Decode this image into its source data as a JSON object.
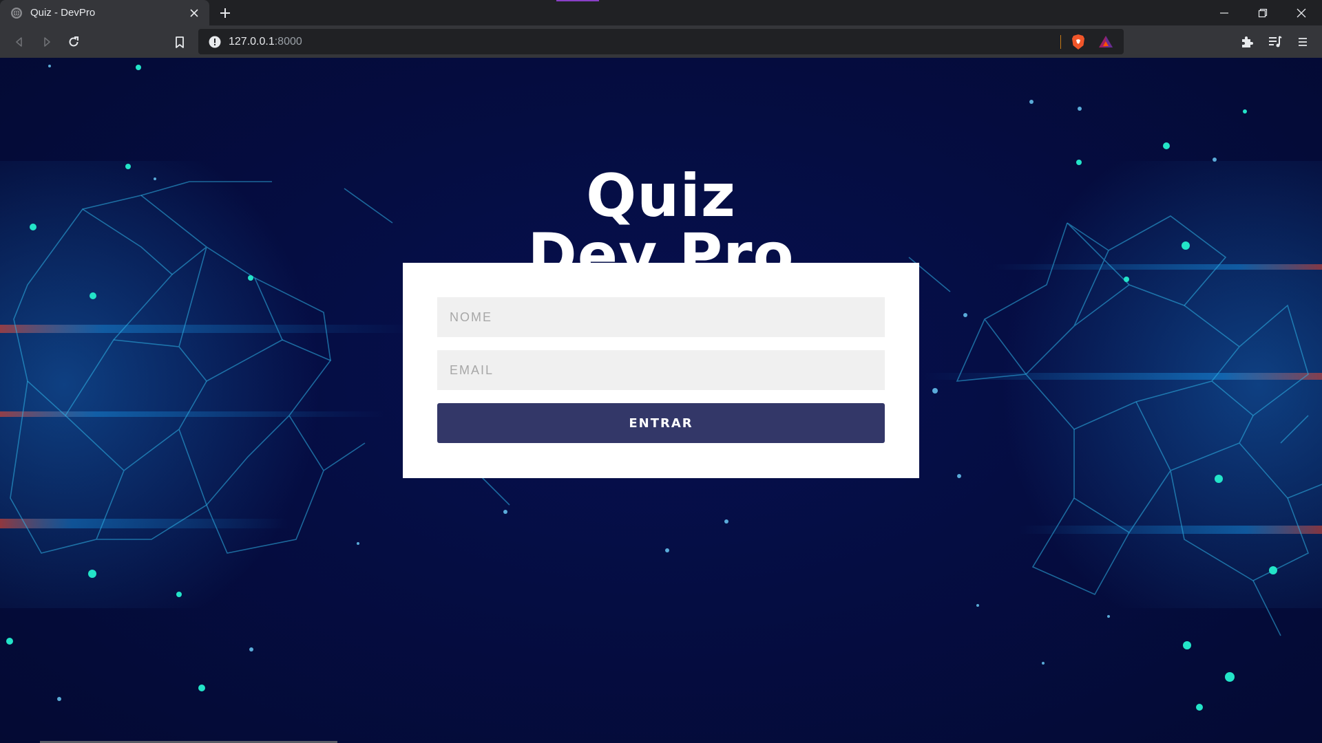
{
  "browser": {
    "tab": {
      "title": "Quiz - DevPro",
      "favicon": "globe-icon",
      "close_icon": "close-icon"
    },
    "new_tab_icon": "plus-icon",
    "window_controls": [
      "minimize-icon",
      "restore-icon",
      "close-icon"
    ],
    "toolbar": {
      "back_icon": "back-arrow-icon",
      "forward_icon": "forward-arrow-icon",
      "reload_icon": "reload-icon",
      "bookmark_icon": "bookmark-icon",
      "url_host": "127.0.0.1",
      "url_port": ":8000",
      "security_icon": "info-warning-icon",
      "shields_icon": "brave-shields-icon",
      "rewards_icon": "brave-rewards-icon",
      "extensions_icon": "puzzle-icon",
      "playlist_icon": "playlist-icon",
      "menu_icon": "hamburger-menu-icon"
    },
    "accent_color": "#8a3fc7"
  },
  "page": {
    "title_line1": "Quiz",
    "title_line2": "Dev Pro",
    "form": {
      "name_placeholder": "NOME",
      "email_placeholder": "EMAIL",
      "submit_label": "ENTRAR",
      "button_color": "#333768"
    },
    "background_color": "#050d42"
  }
}
